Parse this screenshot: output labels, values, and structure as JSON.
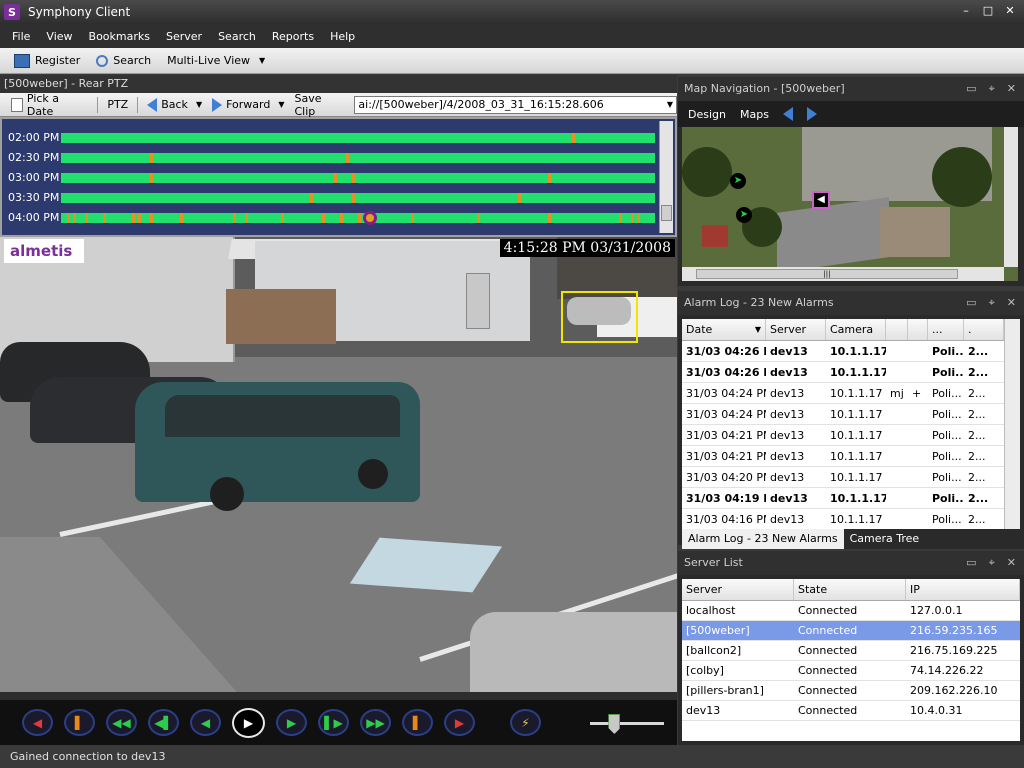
{
  "app": {
    "title": "Symphony Client",
    "logo_letter": "S"
  },
  "window_controls": {
    "minimize": "–",
    "restore": "□",
    "close": "✕"
  },
  "menu": [
    "File",
    "View",
    "Bookmarks",
    "Server",
    "Search",
    "Reports",
    "Help"
  ],
  "toolbar": {
    "register": "Register",
    "search": "Search",
    "multi_live_view": "Multi-Live View"
  },
  "camera_panel": {
    "title": "[500weber] - Rear PTZ",
    "pick_a_date": "Pick a Date",
    "ptz": "PTZ",
    "back": "Back",
    "forward": "Forward",
    "save_clip": "Save Clip",
    "url": "ai://[500weber]/4/2008_03_31_16:15:28.606"
  },
  "timeline": {
    "rows": [
      {
        "label": "02:00 PM",
        "marks": [
          0.86
        ]
      },
      {
        "label": "02:30 PM",
        "marks": [
          0.15,
          0.48
        ]
      },
      {
        "label": "03:00 PM",
        "marks": [
          0.15,
          0.46,
          0.49,
          0.82
        ]
      },
      {
        "label": "03:30 PM",
        "marks": [
          0.42,
          0.49,
          0.77
        ]
      },
      {
        "label": "04:00 PM",
        "marks": [
          0.01,
          0.02,
          0.04,
          0.07,
          0.12,
          0.13,
          0.15,
          0.2,
          0.29,
          0.31,
          0.37,
          0.44,
          0.47,
          0.5,
          0.59,
          0.7,
          0.82,
          0.94,
          0.96,
          0.97
        ],
        "cursor": 0.52
      }
    ]
  },
  "video": {
    "logo": "almetis",
    "timestamp": "4:15:28 PM 03/31/2008"
  },
  "playback": {
    "buttons": [
      "◀",
      "▌",
      "◀◀",
      "◀▌",
      "◀",
      "▶",
      "▶",
      "▌▶",
      "▶▶",
      "▌",
      "▶"
    ],
    "bolt": "⚡",
    "speed": 0.33
  },
  "map_panel": {
    "title": "Map Navigation - [500weber]",
    "design": "Design",
    "maps": "Maps",
    "pan": "|||"
  },
  "alarm_panel": {
    "title": "Alarm Log - 23 New Alarms",
    "headers": [
      "Date",
      "Server",
      "Camera",
      "",
      "",
      "...",
      "."
    ],
    "rows": [
      {
        "date": "31/03 04:26 PM",
        "server": "dev13",
        "camera": "10.1.1.17",
        "c4": "",
        "c5": "",
        "c6": "Poli...",
        "c7": "2...",
        "bold": true
      },
      {
        "date": "31/03 04:26 PM",
        "server": "dev13",
        "camera": "10.1.1.17",
        "c4": "",
        "c5": "",
        "c6": "Poli...",
        "c7": "2...",
        "bold": true
      },
      {
        "date": "31/03 04:24 PM",
        "server": "dev13",
        "camera": "10.1.1.17",
        "c4": "mj",
        "c5": "+",
        "c6": "Poli...",
        "c7": "2...",
        "bold": false
      },
      {
        "date": "31/03 04:24 PM",
        "server": "dev13",
        "camera": "10.1.1.17",
        "c4": "",
        "c5": "",
        "c6": "Poli...",
        "c7": "2...",
        "bold": false
      },
      {
        "date": "31/03 04:21 PM",
        "server": "dev13",
        "camera": "10.1.1.17",
        "c4": "",
        "c5": "",
        "c6": "Poli...",
        "c7": "2...",
        "bold": false
      },
      {
        "date": "31/03 04:21 PM",
        "server": "dev13",
        "camera": "10.1.1.17",
        "c4": "",
        "c5": "",
        "c6": "Poli...",
        "c7": "2...",
        "bold": false
      },
      {
        "date": "31/03 04:20 PM",
        "server": "dev13",
        "camera": "10.1.1.17",
        "c4": "",
        "c5": "",
        "c6": "Poli...",
        "c7": "2...",
        "bold": false
      },
      {
        "date": "31/03 04:19 PM",
        "server": "dev13",
        "camera": "10.1.1.17",
        "c4": "",
        "c5": "",
        "c6": "Poli...",
        "c7": "2...",
        "bold": true
      },
      {
        "date": "31/03 04:16 PM",
        "server": "dev13",
        "camera": "10.1.1.17",
        "c4": "",
        "c5": "",
        "c6": "Poli...",
        "c7": "2...",
        "bold": false
      }
    ],
    "tabs": [
      "Alarm Log - 23 New Alarms",
      "Camera Tree"
    ]
  },
  "server_panel": {
    "title": "Server List",
    "headers": [
      "Server",
      "State",
      "IP"
    ],
    "rows": [
      {
        "server": "localhost",
        "state": "Connected",
        "ip": "127.0.0.1",
        "selected": false
      },
      {
        "server": "[500weber]",
        "state": "Connected",
        "ip": "216.59.235.165",
        "selected": true
      },
      {
        "server": "[ballcon2]",
        "state": "Connected",
        "ip": "216.75.169.225",
        "selected": false
      },
      {
        "server": "[colby]",
        "state": "Connected",
        "ip": "74.14.226.22",
        "selected": false
      },
      {
        "server": "[pillers-bran1]",
        "state": "Connected",
        "ip": "209.162.226.10",
        "selected": false
      },
      {
        "server": "dev13",
        "state": "Connected",
        "ip": "10.4.0.31",
        "selected": false
      }
    ]
  },
  "panel_controls": {
    "float": "▭",
    "pin": "⌖",
    "close": "✕"
  },
  "status": {
    "text": "Gained connection to  dev13"
  },
  "colors": {
    "timeline_bg": "#2d3a6e",
    "timeline_bar": "#22e06e",
    "timeline_mark": "#e89020",
    "selection": "#7a99e6",
    "accent": "#7b2f9a"
  }
}
